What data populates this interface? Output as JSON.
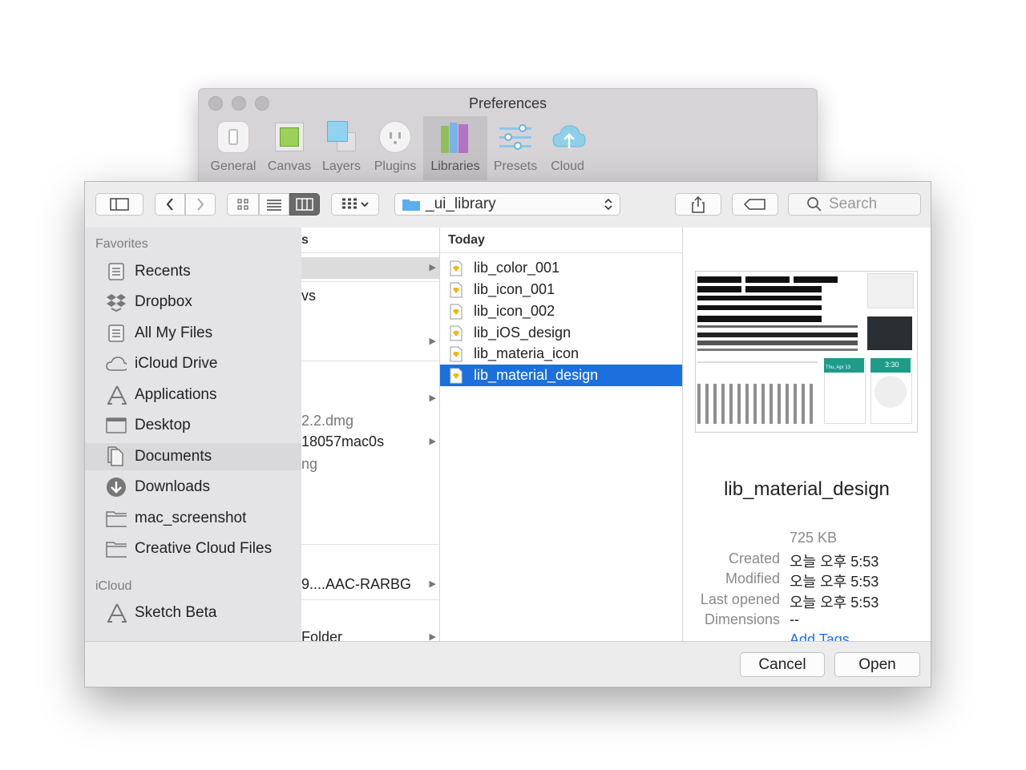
{
  "preferences": {
    "title": "Preferences",
    "tabs": [
      {
        "label": "General",
        "icon": "switch-icon"
      },
      {
        "label": "Canvas",
        "icon": "canvas-icon"
      },
      {
        "label": "Layers",
        "icon": "layers-icon"
      },
      {
        "label": "Plugins",
        "icon": "plugin-outlet-icon"
      },
      {
        "label": "Libraries",
        "icon": "books-icon"
      },
      {
        "label": "Presets",
        "icon": "sliders-icon"
      },
      {
        "label": "Cloud",
        "icon": "cloud-upload-icon"
      }
    ],
    "active_tab": "Libraries"
  },
  "toolbar": {
    "location": "_ui_library",
    "search_placeholder": "Search"
  },
  "sidebar": {
    "favorites_label": "Favorites",
    "favorites": [
      {
        "label": "Recents",
        "icon": "recents-icon"
      },
      {
        "label": "Dropbox",
        "icon": "dropbox-icon"
      },
      {
        "label": "All My Files",
        "icon": "all-files-icon"
      },
      {
        "label": "iCloud Drive",
        "icon": "cloud-icon"
      },
      {
        "label": "Applications",
        "icon": "applications-icon"
      },
      {
        "label": "Desktop",
        "icon": "desktop-icon"
      },
      {
        "label": "Documents",
        "icon": "documents-icon"
      },
      {
        "label": "Downloads",
        "icon": "downloads-icon"
      },
      {
        "label": "mac_screenshot",
        "icon": "folder-icon"
      },
      {
        "label": "Creative Cloud Files",
        "icon": "folder-icon"
      }
    ],
    "selected": "Documents",
    "icloud_label": "iCloud",
    "icloud": [
      {
        "label": "Sketch Beta",
        "icon": "applications-icon"
      }
    ]
  },
  "column1": {
    "header": "s",
    "rows": [
      "",
      "vs",
      "",
      "2.2.dmg",
      "18057mac0s",
      "ng",
      "9....AAC-RARBG",
      "Folder"
    ]
  },
  "column2": {
    "header": "Today",
    "files": [
      "lib_color_001",
      "lib_icon_001",
      "lib_icon_002",
      "lib_iOS_design",
      "lib_materia_icon",
      "lib_material_design"
    ],
    "selected": "lib_material_design"
  },
  "preview": {
    "name": "lib_material_design",
    "size": "725 KB",
    "created_label": "Created",
    "created": "오늘 오후 5:53",
    "modified_label": "Modified",
    "modified": "오늘 오후 5:53",
    "last_opened_label": "Last opened",
    "last_opened": "오늘 오후 5:53",
    "dimensions_label": "Dimensions",
    "dimensions": "--",
    "add_tags": "Add Tags...",
    "thumb_date": "Thu, Apr 13",
    "thumb_time": "3:30"
  },
  "buttons": {
    "cancel": "Cancel",
    "open": "Open"
  },
  "colors": {
    "selection": "#1c6fdd",
    "link": "#1a73e8",
    "material_teal": "#1f9b8a"
  }
}
